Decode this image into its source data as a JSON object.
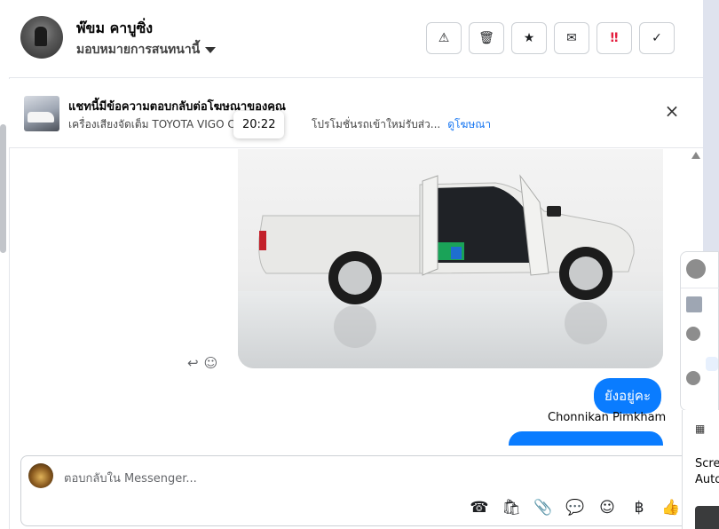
{
  "header": {
    "contact_name": "พ๊ขม คาบูซิ่ง",
    "assign_label": "มอบหมายการสนทนานี้",
    "toolbar": [
      {
        "icon": "alert-icon",
        "glyph": "⚠"
      },
      {
        "icon": "trash-icon",
        "glyph": "🗑"
      },
      {
        "icon": "star-icon",
        "glyph": "★"
      },
      {
        "icon": "mail-icon",
        "glyph": "✉"
      },
      {
        "icon": "spam-icon",
        "glyph": "‼"
      },
      {
        "icon": "check-icon",
        "glyph": "✓"
      }
    ]
  },
  "ad_banner": {
    "title": "แชทนี้มีข้อความตอบกลับต่อโฆษณาของคุณ",
    "description": "เครื่องเสียงจัดเต็ม TOYOTA VIGO CHA",
    "description_tail": "โปรโมชั่นรถเข้าใหม่รับส่ว...",
    "link": "ดูโฆษณา",
    "close_glyph": "×",
    "tooltip_time": "20:22"
  },
  "chat": {
    "reply_glyph": "↩",
    "react_glyph": "☺",
    "outgoing_message": "ยังอยู่คะ",
    "sender_name": "Chonnikan Pimkham"
  },
  "composer": {
    "placeholder": "ตอบกลับใน Messenger...",
    "icons": [
      {
        "name": "call-icon",
        "glyph": "☎"
      },
      {
        "name": "shopping-bag-icon",
        "glyph": "🛍"
      },
      {
        "name": "attachment-icon",
        "glyph": "📎"
      },
      {
        "name": "chat-bubble-icon",
        "glyph": "💬"
      },
      {
        "name": "emoji-icon",
        "glyph": "☺"
      },
      {
        "name": "baht-icon",
        "glyph": "฿"
      },
      {
        "name": "thumbs-up-icon",
        "glyph": "👍"
      }
    ]
  },
  "side_popup": {
    "text_line1": "Scre",
    "text_line2": "Auto"
  },
  "colors": {
    "accent": "#0a7cff",
    "link": "#1877f2",
    "spam_red": "#e41e3f"
  }
}
